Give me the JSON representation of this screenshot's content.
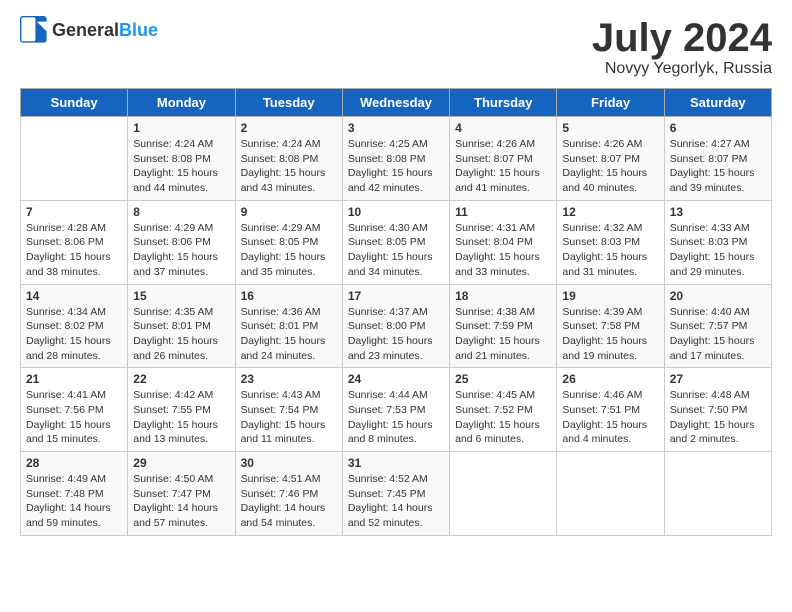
{
  "header": {
    "logo_general": "General",
    "logo_blue": "Blue",
    "month_title": "July 2024",
    "location": "Novyy Yegorlyk, Russia"
  },
  "days_of_week": [
    "Sunday",
    "Monday",
    "Tuesday",
    "Wednesday",
    "Thursday",
    "Friday",
    "Saturday"
  ],
  "weeks": [
    [
      {
        "day": "",
        "info": ""
      },
      {
        "day": "1",
        "info": "Sunrise: 4:24 AM\nSunset: 8:08 PM\nDaylight: 15 hours\nand 44 minutes."
      },
      {
        "day": "2",
        "info": "Sunrise: 4:24 AM\nSunset: 8:08 PM\nDaylight: 15 hours\nand 43 minutes."
      },
      {
        "day": "3",
        "info": "Sunrise: 4:25 AM\nSunset: 8:08 PM\nDaylight: 15 hours\nand 42 minutes."
      },
      {
        "day": "4",
        "info": "Sunrise: 4:26 AM\nSunset: 8:07 PM\nDaylight: 15 hours\nand 41 minutes."
      },
      {
        "day": "5",
        "info": "Sunrise: 4:26 AM\nSunset: 8:07 PM\nDaylight: 15 hours\nand 40 minutes."
      },
      {
        "day": "6",
        "info": "Sunrise: 4:27 AM\nSunset: 8:07 PM\nDaylight: 15 hours\nand 39 minutes."
      }
    ],
    [
      {
        "day": "7",
        "info": "Sunrise: 4:28 AM\nSunset: 8:06 PM\nDaylight: 15 hours\nand 38 minutes."
      },
      {
        "day": "8",
        "info": "Sunrise: 4:29 AM\nSunset: 8:06 PM\nDaylight: 15 hours\nand 37 minutes."
      },
      {
        "day": "9",
        "info": "Sunrise: 4:29 AM\nSunset: 8:05 PM\nDaylight: 15 hours\nand 35 minutes."
      },
      {
        "day": "10",
        "info": "Sunrise: 4:30 AM\nSunset: 8:05 PM\nDaylight: 15 hours\nand 34 minutes."
      },
      {
        "day": "11",
        "info": "Sunrise: 4:31 AM\nSunset: 8:04 PM\nDaylight: 15 hours\nand 33 minutes."
      },
      {
        "day": "12",
        "info": "Sunrise: 4:32 AM\nSunset: 8:03 PM\nDaylight: 15 hours\nand 31 minutes."
      },
      {
        "day": "13",
        "info": "Sunrise: 4:33 AM\nSunset: 8:03 PM\nDaylight: 15 hours\nand 29 minutes."
      }
    ],
    [
      {
        "day": "14",
        "info": "Sunrise: 4:34 AM\nSunset: 8:02 PM\nDaylight: 15 hours\nand 28 minutes."
      },
      {
        "day": "15",
        "info": "Sunrise: 4:35 AM\nSunset: 8:01 PM\nDaylight: 15 hours\nand 26 minutes."
      },
      {
        "day": "16",
        "info": "Sunrise: 4:36 AM\nSunset: 8:01 PM\nDaylight: 15 hours\nand 24 minutes."
      },
      {
        "day": "17",
        "info": "Sunrise: 4:37 AM\nSunset: 8:00 PM\nDaylight: 15 hours\nand 23 minutes."
      },
      {
        "day": "18",
        "info": "Sunrise: 4:38 AM\nSunset: 7:59 PM\nDaylight: 15 hours\nand 21 minutes."
      },
      {
        "day": "19",
        "info": "Sunrise: 4:39 AM\nSunset: 7:58 PM\nDaylight: 15 hours\nand 19 minutes."
      },
      {
        "day": "20",
        "info": "Sunrise: 4:40 AM\nSunset: 7:57 PM\nDaylight: 15 hours\nand 17 minutes."
      }
    ],
    [
      {
        "day": "21",
        "info": "Sunrise: 4:41 AM\nSunset: 7:56 PM\nDaylight: 15 hours\nand 15 minutes."
      },
      {
        "day": "22",
        "info": "Sunrise: 4:42 AM\nSunset: 7:55 PM\nDaylight: 15 hours\nand 13 minutes."
      },
      {
        "day": "23",
        "info": "Sunrise: 4:43 AM\nSunset: 7:54 PM\nDaylight: 15 hours\nand 11 minutes."
      },
      {
        "day": "24",
        "info": "Sunrise: 4:44 AM\nSunset: 7:53 PM\nDaylight: 15 hours\nand 8 minutes."
      },
      {
        "day": "25",
        "info": "Sunrise: 4:45 AM\nSunset: 7:52 PM\nDaylight: 15 hours\nand 6 minutes."
      },
      {
        "day": "26",
        "info": "Sunrise: 4:46 AM\nSunset: 7:51 PM\nDaylight: 15 hours\nand 4 minutes."
      },
      {
        "day": "27",
        "info": "Sunrise: 4:48 AM\nSunset: 7:50 PM\nDaylight: 15 hours\nand 2 minutes."
      }
    ],
    [
      {
        "day": "28",
        "info": "Sunrise: 4:49 AM\nSunset: 7:48 PM\nDaylight: 14 hours\nand 59 minutes."
      },
      {
        "day": "29",
        "info": "Sunrise: 4:50 AM\nSunset: 7:47 PM\nDaylight: 14 hours\nand 57 minutes."
      },
      {
        "day": "30",
        "info": "Sunrise: 4:51 AM\nSunset: 7:46 PM\nDaylight: 14 hours\nand 54 minutes."
      },
      {
        "day": "31",
        "info": "Sunrise: 4:52 AM\nSunset: 7:45 PM\nDaylight: 14 hours\nand 52 minutes."
      },
      {
        "day": "",
        "info": ""
      },
      {
        "day": "",
        "info": ""
      },
      {
        "day": "",
        "info": ""
      }
    ]
  ]
}
